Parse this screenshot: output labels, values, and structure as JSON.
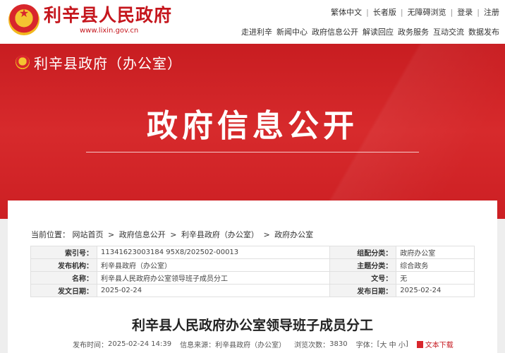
{
  "header": {
    "site_title": "利辛县人民政府",
    "site_url": "www.lixin.gov.cn",
    "top_links": [
      "繁体中文",
      "长者版",
      "无障碍浏览",
      "登录",
      "注册"
    ],
    "nav": [
      "走进利辛",
      "新闻中心",
      "政府信息公开",
      "解读回应",
      "政务服务",
      "互动交流",
      "数据发布"
    ]
  },
  "banner": {
    "org": "利辛县政府（办公室）",
    "title": "政府信息公开"
  },
  "breadcrumb": {
    "prefix": "当前位置：",
    "items": [
      "网站首页",
      "政府信息公开",
      "利辛县政府（办公室）",
      "政府办公室"
    ],
    "separator": ">"
  },
  "meta": {
    "rows": [
      {
        "l1": "索引号：",
        "v1": "11341623003184 95X8/202502-00013",
        "l2": "组配分类：",
        "v2": "政府办公室"
      },
      {
        "l1": "发布机构：",
        "v1": "利辛县政府（办公室）",
        "l2": "主题分类：",
        "v2": "综合政务"
      },
      {
        "l1": "名称：",
        "v1": "利辛县人民政府办公室领导班子成员分工",
        "l2": "文号：",
        "v2": "无"
      },
      {
        "l1": "发文日期：",
        "v1": "2025-02-24",
        "l2": "发布日期：",
        "v2": "2025-02-24"
      }
    ]
  },
  "article": {
    "title": "利辛县人民政府办公室领导班子成员分工",
    "published_label": "发布时间：",
    "published_value": "2025-02-24 14:39",
    "source_label": "信息来源：",
    "source_value": "利辛县政府（办公室）",
    "views_label": "浏览次数：",
    "views_value": "3830",
    "font_label": "字体：",
    "font_open": "[",
    "font_sizes": [
      "大",
      "中",
      "小"
    ],
    "font_close": "]",
    "download_label": "文本下载"
  },
  "colors": {
    "brand_red": "#c5161d",
    "banner_red": "#d72a2c"
  }
}
